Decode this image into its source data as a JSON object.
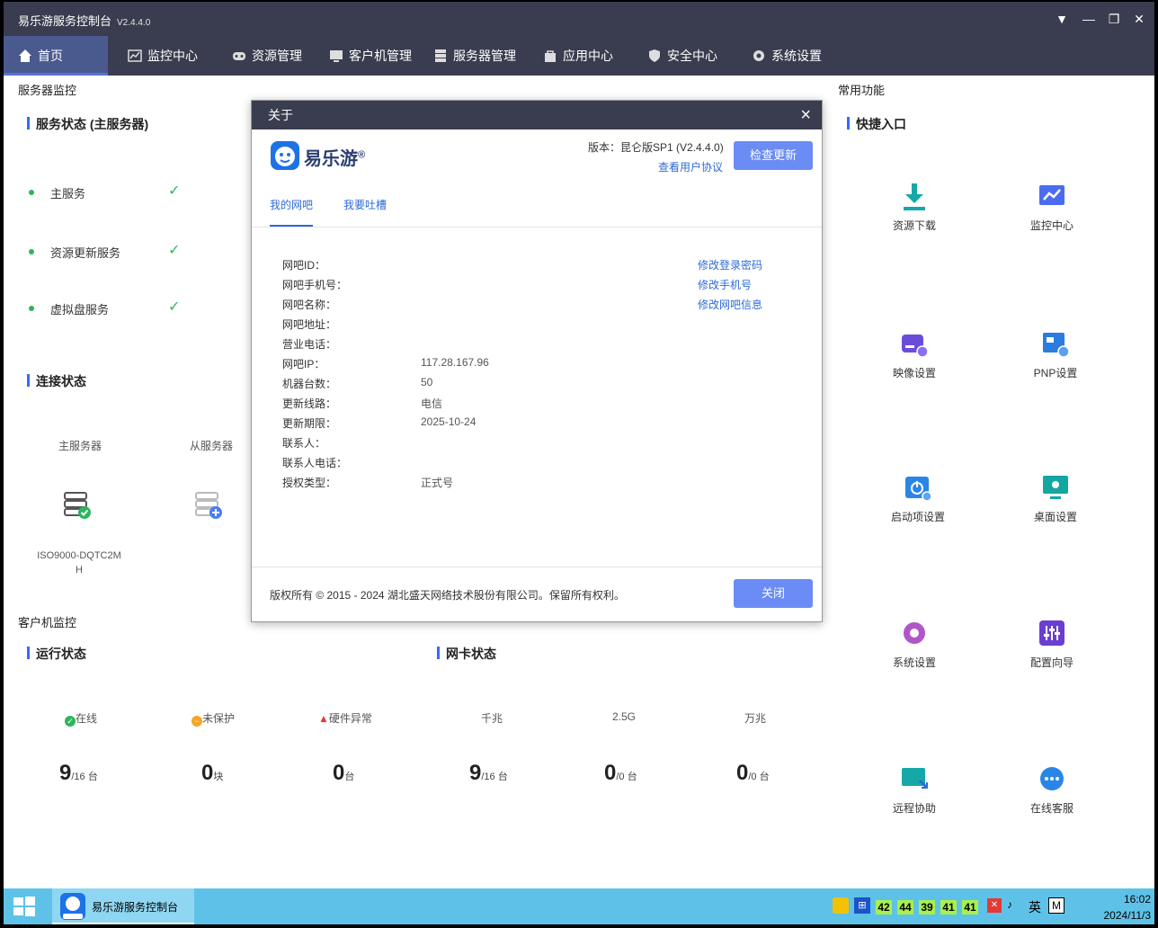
{
  "window": {
    "title": "易乐游服务控制台",
    "version": "V2.4.4.0"
  },
  "nav": [
    {
      "label": "首页",
      "icon": "home-icon"
    },
    {
      "label": "监控中心",
      "icon": "chart-icon"
    },
    {
      "label": "资源管理",
      "icon": "gamepad-icon"
    },
    {
      "label": "客户机管理",
      "icon": "monitor-icon"
    },
    {
      "label": "服务器管理",
      "icon": "server-icon"
    },
    {
      "label": "应用中心",
      "icon": "bag-icon"
    },
    {
      "label": "安全中心",
      "icon": "shield-icon"
    },
    {
      "label": "系统设置",
      "icon": "gear-icon"
    }
  ],
  "server_monitor": {
    "title": "服务器监控",
    "status_title": "服务状态 (主服务器)",
    "services": [
      "主服务",
      "资源更新服务",
      "虚拟盘服务"
    ],
    "conn_title": "连接状态",
    "main_server": "主服务器",
    "sub_server": "从服务器",
    "server_name": "ISO9000-DQTC2MH"
  },
  "client_monitor": {
    "title": "客户机监控",
    "run_title": "运行状态",
    "nic_title": "网卡状态",
    "online_label": "在线",
    "unprotected_label": "未保护",
    "hw_label": "硬件异常",
    "g1_label": "千兆",
    "g25_label": "2.5G",
    "g10_label": "万兆",
    "online_val": "9",
    "online_unit": "/16 台",
    "unprotected_val": "0",
    "unprotected_unit": "块",
    "hw_val": "0",
    "hw_unit": "台",
    "g1_val": "9",
    "g1_unit": "/16 台",
    "g25_val": "0",
    "g25_unit": "/0 台",
    "g10_val": "0",
    "g10_unit": "/0 台"
  },
  "quick": {
    "title": "常用功能",
    "entry_title": "快捷入口",
    "items": [
      "资源下载",
      "监控中心",
      "映像设置",
      "PNP设置",
      "启动项设置",
      "桌面设置",
      "系统设置",
      "配置向导",
      "远程协助",
      "在线客服"
    ]
  },
  "dialog": {
    "title": "关于",
    "logo_text": "易乐游",
    "version_text": "版本：昆仑版SP1 (V2.4.4.0)",
    "agreement_link": "查看用户协议",
    "check_update": "检查更新",
    "tab1": "我的网吧",
    "tab2": "我要吐槽",
    "fields": [
      {
        "label": "网吧ID：",
        "value": ""
      },
      {
        "label": "网吧手机号：",
        "value": ""
      },
      {
        "label": "网吧名称：",
        "value": ""
      },
      {
        "label": "网吧地址：",
        "value": ""
      },
      {
        "label": "营业电话：",
        "value": ""
      },
      {
        "label": "网吧IP：",
        "value": "117.28.167.96"
      },
      {
        "label": "机器台数：",
        "value": "50"
      },
      {
        "label": "更新线路：",
        "value": "电信"
      },
      {
        "label": "更新期限：",
        "value": "2025-10-24"
      },
      {
        "label": "联系人：",
        "value": ""
      },
      {
        "label": "联系人电话：",
        "value": ""
      },
      {
        "label": "授权类型：",
        "value": "正式号"
      }
    ],
    "links": [
      "修改登录密码",
      "修改手机号",
      "修改网吧信息"
    ],
    "copyright": "版权所有 © 2015 - 2024  湖北盛天网络技术股份有限公司。保留所有权利。",
    "close": "关闭"
  },
  "taskbar": {
    "app_label": "易乐游服务控制台",
    "tray_nums": [
      "42",
      "44",
      "39",
      "41",
      "41"
    ],
    "ime": "英",
    "ime2": "M",
    "time": "16:02",
    "date": "2024/11/3"
  }
}
